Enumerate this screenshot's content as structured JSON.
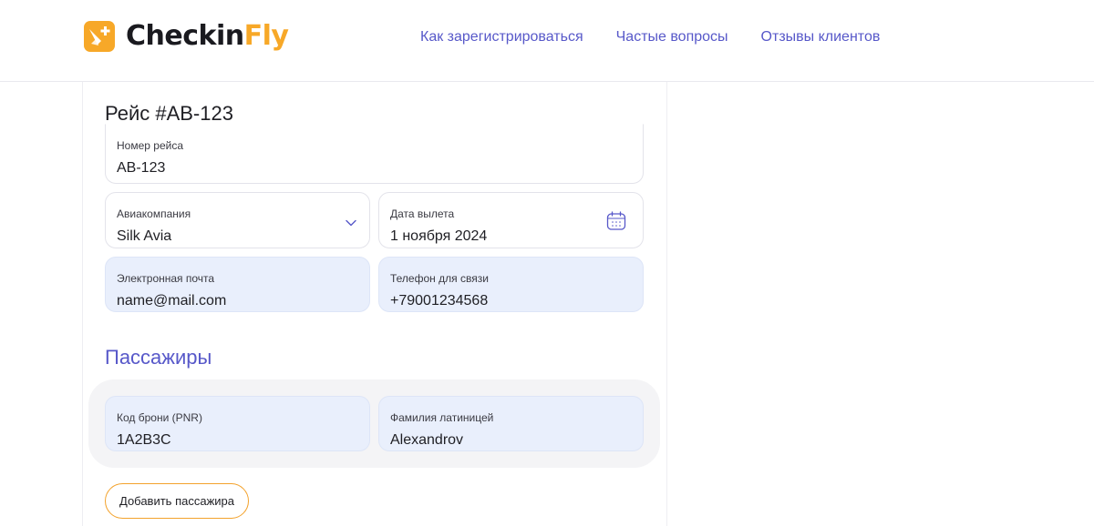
{
  "brand": {
    "name_part1": "Checkin",
    "name_part2": "Fly",
    "logo_color": "#f7a828",
    "logo_icon": "plane-plus-icon"
  },
  "nav": {
    "items": [
      {
        "label": "Как зарегистрироваться"
      },
      {
        "label": "Частые вопросы"
      },
      {
        "label": "Отзывы клиентов"
      }
    ],
    "color": "#5758c9"
  },
  "flight": {
    "title": "Рейс #AB-123",
    "number": {
      "label": "Номер рейса",
      "value": "AB-123"
    },
    "airline": {
      "label": "Авиакомпания",
      "value": "Silk Avia",
      "icon": "chevron-down-icon"
    },
    "date": {
      "label": "Дата вылета",
      "value": "1 ноября 2024",
      "icon": "calendar-icon"
    },
    "email": {
      "label": "Электронная почта",
      "value": "name@mail.com"
    },
    "phone": {
      "label": "Телефон для связи",
      "value": "+79001234568"
    }
  },
  "passengers": {
    "title": "Пассажиры",
    "items": [
      {
        "pnr": {
          "label": "Код брони (PNR)",
          "value": "1A2B3C"
        },
        "lastname": {
          "label": "Фамилия латиницей",
          "value": "Alexandrov"
        }
      }
    ],
    "add_label": "Добавить пассажира"
  },
  "colors": {
    "accent": "#5758c9",
    "brand_orange": "#f7a828",
    "filled_field": "#e9effc",
    "card_bg": "#f4f4f6"
  }
}
